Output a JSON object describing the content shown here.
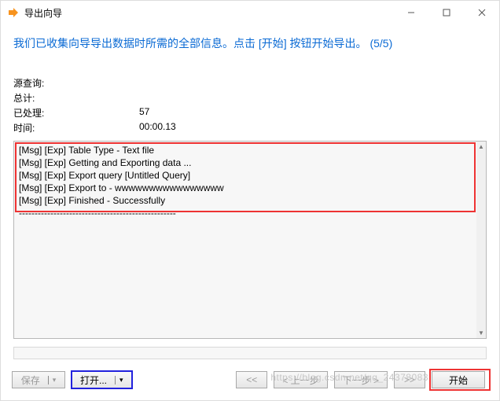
{
  "window": {
    "title": "导出向导",
    "min_icon": "minimize-icon",
    "max_icon": "maximize-icon",
    "close_icon": "close-icon"
  },
  "instruction": "我们已收集向导导出数据时所需的全部信息。点击 [开始] 按钮开始导出。  (5/5)",
  "stats": {
    "source_label": "源查询:",
    "source_value": "",
    "total_label": "总计:",
    "total_value": "",
    "processed_label": "已处理:",
    "processed_value": "57",
    "time_label": "时间:",
    "time_value": "00:00.13"
  },
  "log": {
    "lines": [
      "[Msg] [Exp] Table Type - Text file",
      "[Msg] [Exp] Getting and Exporting data ...",
      "[Msg] [Exp] Export query [Untitled Query]",
      "[Msg] [Exp] Export to - wwwwwwwwwwwwwwww",
      "[Msg] [Exp] Finished - Successfully",
      "--------------------------------------------------"
    ]
  },
  "buttons": {
    "save": "保存",
    "open": "打开...",
    "first": "<<",
    "prev": "< 上一步",
    "next": "下一步 >",
    "last": ">>",
    "start": "开始"
  },
  "watermark": "https://blog.csdn.net/qq_24378083"
}
